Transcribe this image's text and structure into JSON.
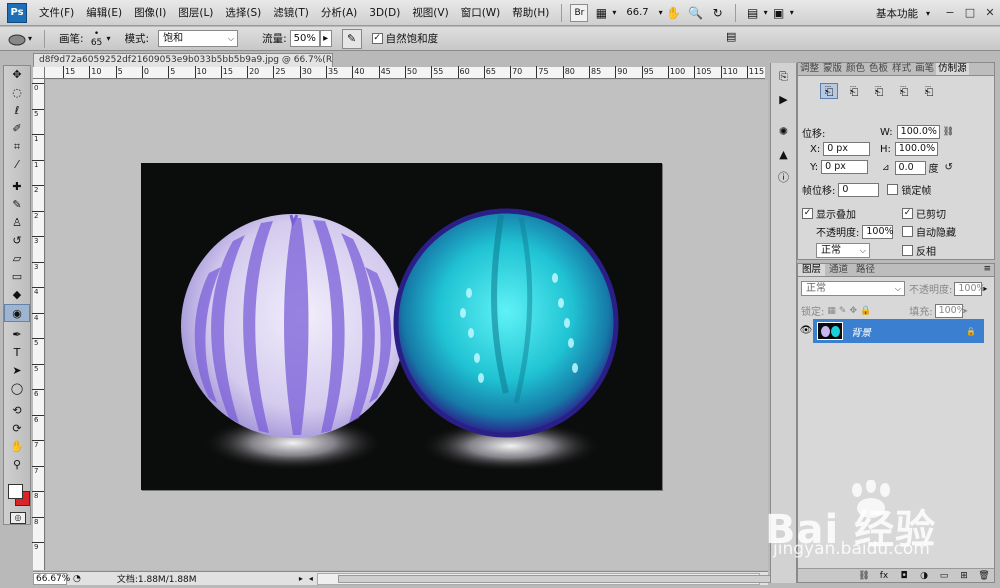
{
  "app": {
    "logo": "Ps"
  },
  "menu": {
    "items": [
      "文件(F)",
      "编辑(E)",
      "图像(I)",
      "图层(L)",
      "选择(S)",
      "滤镜(T)",
      "分析(A)",
      "3D(D)",
      "视图(V)",
      "窗口(W)",
      "帮助(H)"
    ],
    "br_label": "Br",
    "zoom": "66.7",
    "workspace": "基本功能"
  },
  "options": {
    "brush_label": "画笔:",
    "brush_size": "65",
    "mode_label": "模式:",
    "mode_value": "饱和",
    "flow_label": "流量:",
    "flow_value": "50%",
    "natural_saturation_label": "自然饱和度",
    "natural_saturation_checked": true
  },
  "document": {
    "tab_title": "d8f9d72a6059252df21609053e9b033b5bb5b9a9.jpg @ 66.7%(RGB/8) *",
    "ruler_top": [
      "15",
      "10",
      "5",
      "0",
      "5",
      "10",
      "15",
      "20",
      "25",
      "30",
      "35",
      "40",
      "45",
      "50",
      "55",
      "60",
      "65",
      "70",
      "75",
      "80",
      "85",
      "90",
      "95",
      "100",
      "105",
      "110",
      "115"
    ],
    "ruler_left": [
      "0",
      "5",
      "1",
      "1",
      "2",
      "2",
      "3",
      "3",
      "4",
      "4",
      "5",
      "5",
      "6",
      "6",
      "7",
      "7",
      "8",
      "8",
      "9"
    ],
    "zoom": "66.67%",
    "info": "文档:1.88M/1.88M"
  },
  "clone_panel": {
    "tabs": [
      "调整",
      "蒙版",
      "颜色",
      "色板",
      "样式",
      "画笔",
      "仿制源"
    ],
    "active_tab": 6,
    "offset_label": "位移:",
    "w_label": "W:",
    "w_value": "100.0%",
    "x_label": "X:",
    "x_value": "0 px",
    "h_label": "H:",
    "h_value": "100.0%",
    "y_label": "Y:",
    "y_value": "0 px",
    "angle_value": "0.0",
    "angle_unit": "度",
    "frame_offset_label": "帧位移:",
    "frame_offset_value": "0",
    "lock_frame_label": "锁定帧",
    "show_overlay_label": "显示叠加",
    "show_overlay_checked": true,
    "clipped_label": "已剪切",
    "clipped_checked": true,
    "opacity_label": "不透明度:",
    "opacity_value": "100%",
    "auto_hide_label": "自动隐藏",
    "blend_value": "正常",
    "invert_label": "反相"
  },
  "layers_panel": {
    "tabs": [
      "图层",
      "通道",
      "路径"
    ],
    "active_tab": 0,
    "blend_mode": "正常",
    "opacity_label": "不透明度:",
    "opacity_value": "100%",
    "lock_label": "锁定:",
    "fill_label": "填充:",
    "fill_value": "100%",
    "layer_name": "背景"
  },
  "watermark": {
    "brand": "Bai 经验",
    "site": "jingyan.baidu.com"
  },
  "colors": {
    "selection_blue": "#3b7fd1",
    "background_swatch": "#d9252a",
    "foreground_swatch": "#ffffff"
  }
}
